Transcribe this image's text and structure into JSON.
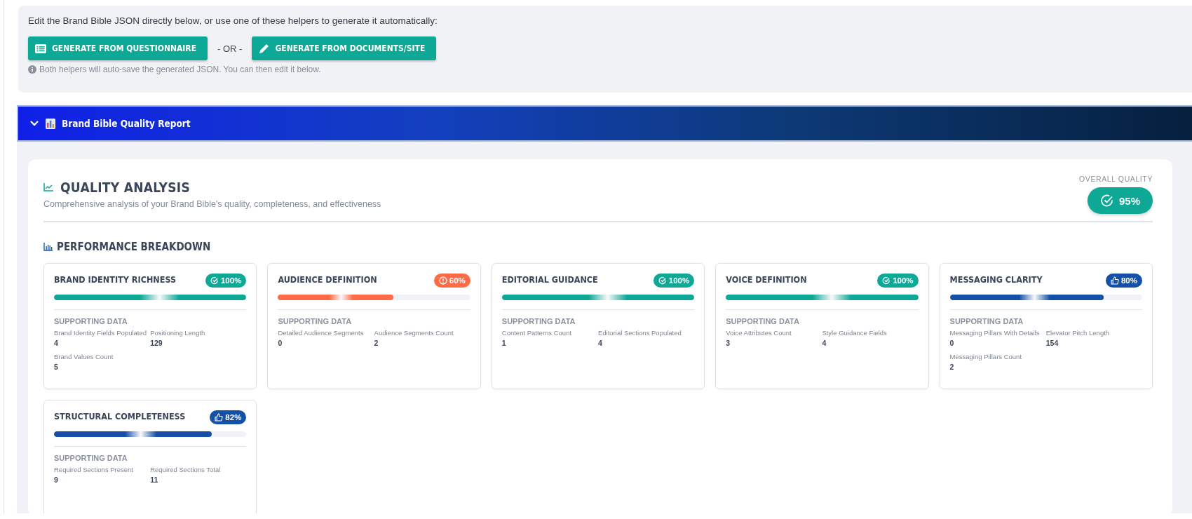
{
  "helpers": {
    "intro": "Edit the Brand Bible JSON directly below, or use one of these helpers to generate it automatically:",
    "buttons": [
      {
        "label": "GENERATE FROM QUESTIONNAIRE",
        "kind": "list"
      },
      {
        "label": "GENERATE FROM DOCUMENTS/SITE",
        "kind": "pencil"
      }
    ],
    "separator": "- OR -",
    "note": "Both helpers will auto-save the generated JSON. You can then edit it below."
  },
  "report": {
    "title": "Brand Bible Quality Report",
    "expanded": true
  },
  "analysis": {
    "title": "QUALITY ANALYSIS",
    "subtitle": "Comprehensive analysis of your Brand Bible's quality, completeness, and effectiveness",
    "overall_label": "OVERALL QUALITY",
    "overall_value": "95%"
  },
  "breakdown": {
    "title": "PERFORMANCE BREAKDOWN",
    "metrics": [
      {
        "title": "BRAND IDENTITY RICHNESS",
        "kind": "good",
        "badge": "100%",
        "level": 1,
        "supporting_label": "SUPPORTING DATA",
        "stats": [
          {
            "label": "Brand Identity Fields Populated",
            "value": "4"
          },
          {
            "label": "Positioning Length",
            "value": "129"
          },
          {
            "label": "Brand Values Count",
            "value": "5"
          }
        ]
      },
      {
        "title": "AUDIENCE DEFINITION",
        "kind": "warning",
        "badge": "60%",
        "level": 0.6,
        "supporting_label": "SUPPORTING DATA",
        "stats": [
          {
            "label": "Detailed Audience Segments",
            "value": "0"
          },
          {
            "label": "Audience Segments Count",
            "value": "2"
          }
        ]
      },
      {
        "title": "EDITORIAL GUIDANCE",
        "kind": "good",
        "badge": "100%",
        "level": 1,
        "supporting_label": "SUPPORTING DATA",
        "stats": [
          {
            "label": "Content Patterns Count",
            "value": "1"
          },
          {
            "label": "Editorial Sections Populated",
            "value": "4"
          }
        ]
      },
      {
        "title": "VOICE DEFINITION",
        "kind": "good",
        "badge": "100%",
        "level": 1,
        "supporting_label": "SUPPORTING DATA",
        "stats": [
          {
            "label": "Voice Attributes Count",
            "value": "3"
          },
          {
            "label": "Style Guidance Fields",
            "value": "4"
          }
        ]
      },
      {
        "title": "MESSAGING CLARITY",
        "kind": "fair",
        "badge": "80%",
        "level": 0.8,
        "supporting_label": "SUPPORTING DATA",
        "stats": [
          {
            "label": "Messaging Pillars With Details",
            "value": "0"
          },
          {
            "label": "Elevator Pitch Length",
            "value": "154"
          },
          {
            "label": "Messaging Pillars Count",
            "value": "2"
          }
        ]
      },
      {
        "title": "STRUCTURAL COMPLETENESS",
        "kind": "fair",
        "badge": "82%",
        "level": 0.82,
        "supporting_label": "SUPPORTING DATA",
        "stats": [
          {
            "label": "Required Sections Present",
            "value": "9"
          },
          {
            "label": "Required Sections Total",
            "value": "11"
          }
        ]
      }
    ]
  }
}
